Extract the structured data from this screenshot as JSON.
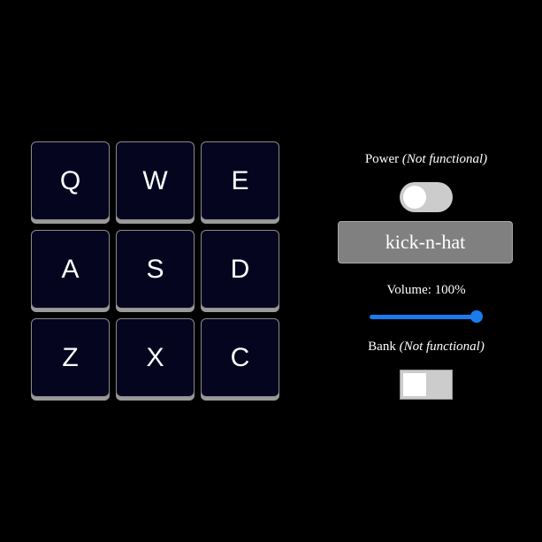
{
  "pads": [
    {
      "key": "Q"
    },
    {
      "key": "W"
    },
    {
      "key": "E"
    },
    {
      "key": "A"
    },
    {
      "key": "S"
    },
    {
      "key": "D"
    },
    {
      "key": "Z"
    },
    {
      "key": "X"
    },
    {
      "key": "C"
    }
  ],
  "power": {
    "label": "Power ",
    "note": "(Not functional)",
    "state": "off"
  },
  "display": {
    "text": "kick-n-hat"
  },
  "volume": {
    "label": "Volume: 100%",
    "value": 1.0
  },
  "bank": {
    "label": "Bank ",
    "note": "(Not functional)",
    "state": "off"
  },
  "colors": {
    "background": "#000000",
    "pad": "#05051f",
    "accent": "#1a7cf0",
    "display": "#808080"
  }
}
